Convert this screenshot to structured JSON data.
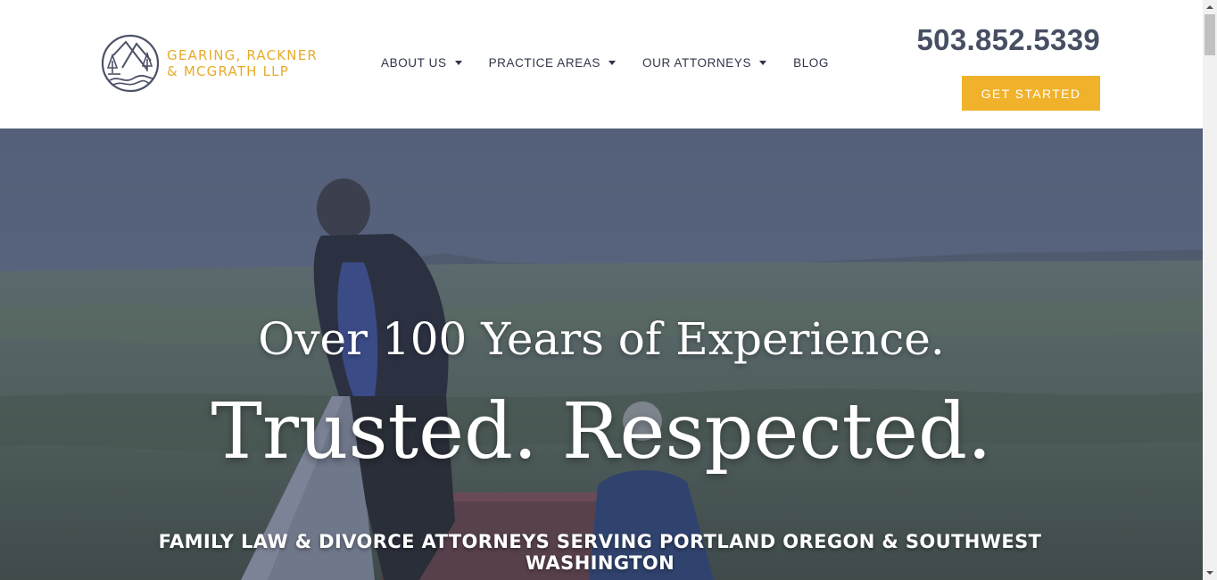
{
  "header": {
    "logo": {
      "line1": "GEARING, RACKNER",
      "line2": "& MCGRATH LLP",
      "icon": "mountain-trees-river-logo-icon"
    },
    "nav": [
      {
        "label": "ABOUT US",
        "has_dropdown": true
      },
      {
        "label": "PRACTICE AREAS",
        "has_dropdown": true
      },
      {
        "label": "OUR ATTORNEYS",
        "has_dropdown": true
      },
      {
        "label": "BLOG",
        "has_dropdown": false
      }
    ],
    "phone": "503.852.5339",
    "cta_label": "GET STARTED"
  },
  "hero": {
    "headline": "Over 100 Years of Experience.",
    "tagline": "Trusted. Respected.",
    "subheading": "FAMILY LAW & DIVORCE ATTORNEYS SERVING PORTLAND OREGON & SOUTHWEST WASHINGTON"
  },
  "colors": {
    "brand_gold": "#f0b22b",
    "logo_gold": "#e8ab2a",
    "nav_text": "#2f3548",
    "phone_text": "#474f63",
    "hero_overlay": "#55607c"
  }
}
